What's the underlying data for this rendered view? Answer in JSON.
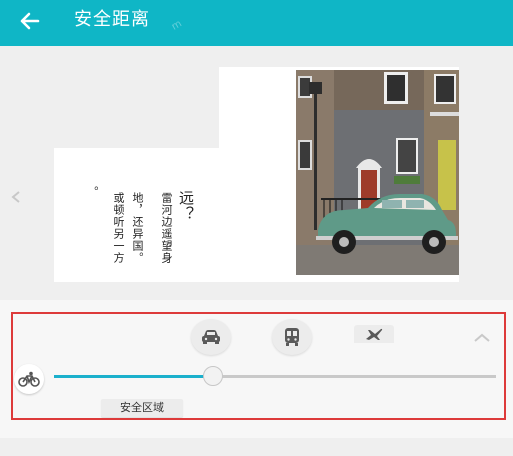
{
  "header": {
    "title": "安全距离",
    "back_icon": "back-arrow-icon",
    "watermark": "m",
    "background_color": "#0fb6c6"
  },
  "page_preview": {
    "text_columns": [
      "远？",
      "雷河边遥望身",
      "地，还异国。",
      "或顿听另一方",
      "。"
    ],
    "photo_alt": "green-vintage-car-in-front-of-brick-house"
  },
  "transport_modes": [
    {
      "name": "car",
      "icon": "car-icon"
    },
    {
      "name": "bus",
      "icon": "bus-icon"
    },
    {
      "name": "plane",
      "icon": "plane-icon"
    }
  ],
  "slider": {
    "icon": "bicycle-icon",
    "value_fraction": 0.36,
    "label": "安全区域",
    "fill_color": "#1bb0cc"
  },
  "highlight_color": "#dd3a3a"
}
